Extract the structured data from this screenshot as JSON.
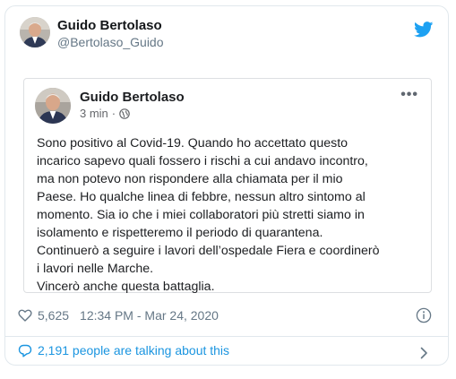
{
  "tweet": {
    "author_name": "Guido Bertolaso",
    "author_handle": "@Bertolaso_Guido",
    "brand_color": "#1da1f2",
    "like_count": "5,625",
    "timestamp": "12:34 PM - Mar 24, 2020",
    "talking_text": "2,191 people are talking about this",
    "link_color": "#1b95e0"
  },
  "fb_post": {
    "author_name": "Guido Bertolaso",
    "time_ago": "3 min",
    "separator": "·",
    "more_label": "•••",
    "lines": [
      "Sono positivo al Covid-19. Quando ho accettato questo",
      "incarico sapevo quali fossero i rischi a cui andavo incontro,",
      "ma non potevo non rispondere alla chiamata per il mio",
      "Paese. Ho qualche linea di febbre, nessun altro sintomo al",
      "momento. Sia io che i miei collaboratori più stretti siamo in",
      "isolamento e rispetteremo il periodo di quarantena.",
      "Continuerò a seguire i lavori dell’ospedale Fiera e coordinerò",
      "i lavori nelle Marche.",
      "Vincerò anche questa battaglia."
    ]
  },
  "icons": {
    "twitter": "twitter-bird-icon",
    "globe": "globe-icon",
    "heart": "heart-icon",
    "info": "info-icon",
    "bubble": "speech-bubble-icon",
    "chevron": "chevron-right-icon"
  }
}
